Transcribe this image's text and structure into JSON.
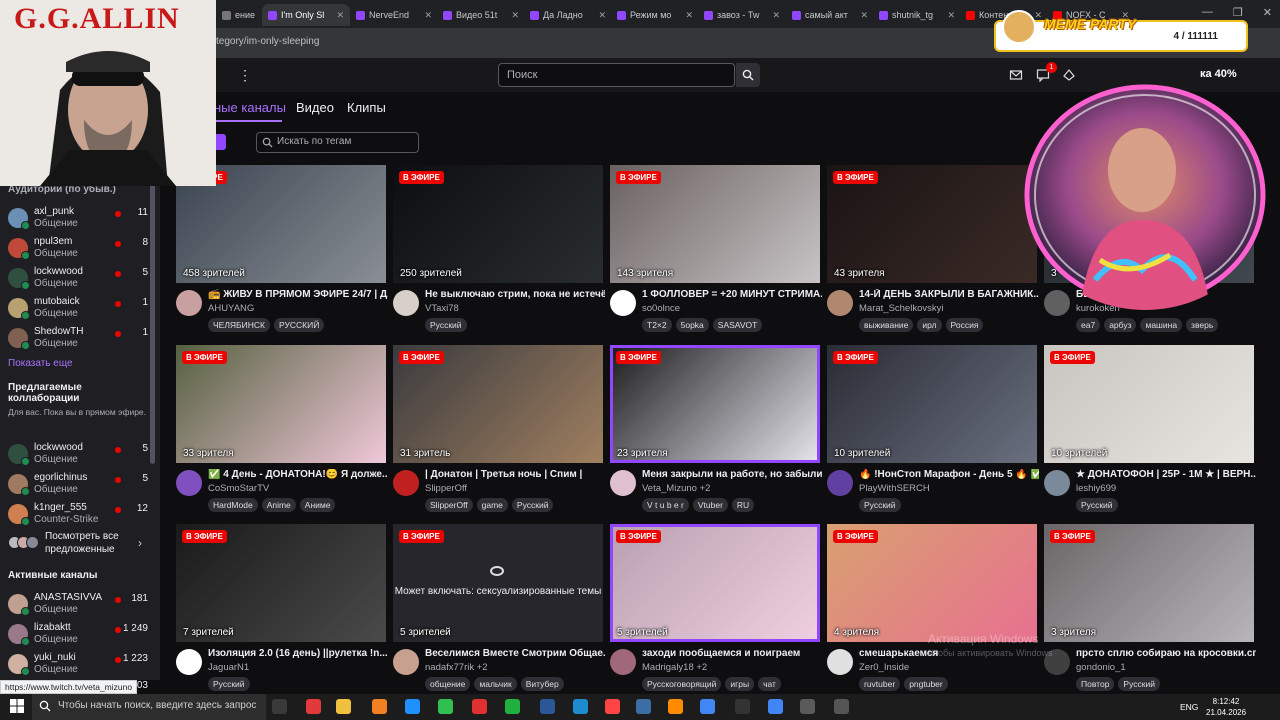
{
  "browser": {
    "tabs": [
      {
        "label": "ение",
        "fav": "#777777"
      },
      {
        "label": "I'm Only Sl",
        "fav": "#9147ff",
        "active": true
      },
      {
        "label": "NerveEnd",
        "fav": "#9147ff"
      },
      {
        "label": "Видео 51t",
        "fav": "#9147ff"
      },
      {
        "label": "Да Ладно",
        "fav": "#9147ff"
      },
      {
        "label": "Режим мо",
        "fav": "#9147ff"
      },
      {
        "label": "завоз - Tw",
        "fav": "#9147ff"
      },
      {
        "label": "самый акт",
        "fav": "#9147ff"
      },
      {
        "label": "shutnik_tg",
        "fav": "#9147ff"
      },
      {
        "label": "Контент",
        "fav": "#ff0000"
      },
      {
        "label": "NOFX - C",
        "fav": "#ff0000"
      }
    ],
    "url": "tegory/im-only-sleeping",
    "window_controls": [
      "—",
      "❐",
      "✕"
    ]
  },
  "topnav": {
    "search_placeholder": "Поиск",
    "notifications_count": "1",
    "prime_percent": "ка 40%"
  },
  "sidebar": {
    "audience_heading": "Аудитории (по убыв.)",
    "followed": [
      {
        "name": "axl_punk",
        "game": "Общение",
        "viewers": "11",
        "color": "#6b8fb5"
      },
      {
        "name": "npul3em",
        "game": "Общение",
        "viewers": "8",
        "color": "#c04a3a"
      },
      {
        "name": "lockwwood",
        "game": "Общение",
        "viewers": "5",
        "color": "#2f4f3f"
      },
      {
        "name": "mutobaick",
        "game": "Общение",
        "viewers": "1",
        "color": "#b8a070"
      },
      {
        "name": "ShedowTH",
        "game": "Общение",
        "viewers": "1",
        "color": "#806050"
      }
    ],
    "show_more": "Показать еще",
    "collab_heading": "Предлагаемые коллаборации",
    "collab_sub": "Для вас. Пока вы в прямом эфире.",
    "collabs": [
      {
        "name": "lockwwood",
        "game": "Общение",
        "viewers": "5",
        "color": "#2f4f3f"
      },
      {
        "name": "egorlichinus",
        "game": "Общение",
        "viewers": "5",
        "color": "#a07a60"
      },
      {
        "name": "k1nger_555",
        "game": "Counter-Strike",
        "viewers": "12",
        "color": "#d08050"
      }
    ],
    "see_all": "Посмотреть все предложенные",
    "active_heading": "Активные каналы",
    "active": [
      {
        "name": "ANASTASIVVA",
        "game": "Общение",
        "viewers": "181",
        "color": "#c0a090"
      },
      {
        "name": "lizabaktt",
        "game": "Общение",
        "viewers": "1 249",
        "color": "#9a7a8a"
      },
      {
        "name": "yuki_nuki",
        "game": "Общение",
        "viewers": "1 223",
        "color": "#d0b0a0"
      }
    ],
    "partial_count": "03"
  },
  "content": {
    "tabs": [
      "ные каналы",
      "Видео",
      "Клипы"
    ],
    "tag_search_placeholder": "Искать по тегам",
    "live_label": "В ЭФИРЕ"
  },
  "cards": [
    {
      "viewers": "458 зрителей",
      "title": "📻 ЖИВУ В ПРЯМОМ ЭФИРЕ 24/7 | Д...",
      "channel": "AHUYANG",
      "tags": [
        "ЧЕЛЯБИНСК",
        "РУССКИЙ"
      ],
      "thumb": "#3a4450",
      "thumb2": "#8a8f95",
      "avatar": "#c9a0a0"
    },
    {
      "viewers": "250 зрителей",
      "title": "Не выключаю стрим, пока не истечё...",
      "channel": "VTaxi78",
      "tags": [
        "Русский"
      ],
      "thumb": "#0c0e12",
      "thumb2": "#2a2d30",
      "avatar": "#d8d0c8"
    },
    {
      "viewers": "143 зрителя",
      "title": "1 ФОЛЛОВЕР = +20 МИНУТ СТРИМА...",
      "channel": "so0olnce",
      "tags": [
        "T2×2",
        "5opka",
        "SASAVOT"
      ],
      "thumb": "#6a6060",
      "thumb2": "#c8c4c6",
      "avatar": "#ffffff"
    },
    {
      "viewers": "43 зрителя",
      "title": "14-Й ДЕНЬ ЗАКРЫЛИ В БАГАЖНИК...",
      "channel": "Marat_Schelkovskyi",
      "tags": [
        "выживание",
        "ирл",
        "Россия"
      ],
      "thumb": "#1a1414",
      "thumb2": "#3a2a26",
      "avatar": "#b08870"
    },
    {
      "viewers": "3",
      "title": "БЕСК... 2 ДЕНЬ | Н...",
      "channel": "kurokoken",
      "tags": [
        "ea7",
        "арбуз",
        "машина",
        "зверь"
      ],
      "thumb": "#20242a",
      "thumb2": "#404850",
      "avatar": "#606060"
    },
    {
      "viewers": "33 зрителя",
      "title": "✅ 4 День - ДОНАТОНА!😊 Я долже...",
      "channel": "CoSmoStarTV",
      "tags": [
        "HardMode",
        "Anime",
        "Аниме"
      ],
      "thumb": "#556040",
      "thumb2": "#f0c8d8",
      "avatar": "#8050c0"
    },
    {
      "viewers": "31 зритель",
      "title": "| Донатон | Третья ночь | Спим |",
      "channel": "SlipperOff",
      "tags": [
        "SlipperOff",
        "game",
        "Русский"
      ],
      "thumb": "#3a3a3e",
      "thumb2": "#a08060",
      "avatar": "#c02020"
    },
    {
      "viewers": "23 зрителя",
      "title": "Меня закрыли на работе, но забыли ...",
      "channel": "Veta_Mizuno +2",
      "tags": [
        "V t u b e r",
        "Vtuber",
        "RU"
      ],
      "thumb": "#1a1a1c",
      "thumb2": "#e8e6ee",
      "avatar": "#e0c0d0",
      "highlight": true
    },
    {
      "viewers": "10 зрителей",
      "title": "🔥 !НонСтоп Марафон - День 5 🔥 ✅...",
      "channel": "PlayWithSERCH",
      "tags": [
        "Русский"
      ],
      "thumb": "#2a2c34",
      "thumb2": "#6a7080",
      "avatar": "#6040a0"
    },
    {
      "viewers": "10 зрителей",
      "title": "★ ДОНАТОФОН | 25P - 1M ★ | ВЕРН...",
      "channel": "leshiy699",
      "tags": [
        "Русский"
      ],
      "thumb": "#c8c4c0",
      "thumb2": "#e8e4e0",
      "avatar": "#7a8a9a"
    },
    {
      "viewers": "7 зрителей",
      "title": "Изоляция 2.0 (16 день) ||рулетка !n...",
      "channel": "JaguarN1",
      "tags": [
        "Русский"
      ],
      "thumb": "#1a1a1a",
      "thumb2": "#4a4a4a",
      "avatar": "#ffffff"
    },
    {
      "viewers": "5 зрителей",
      "title": "Веселимся Вместе Смотрим Общае...",
      "channel": "nadafx77rik +2",
      "tags": [
        "общение",
        "мальчик",
        "Витубер"
      ],
      "thumb": "#26262c",
      "thumb2": "#26262c",
      "avatar": "#c8a090",
      "mature": "Может включать: сексуализированные темы"
    },
    {
      "viewers": "5 зрителей",
      "title": "заходи пообщаемся и поиграем",
      "channel": "Madrigaly18 +2",
      "tags": [
        "Русскоговорящий",
        "игры",
        "чат"
      ],
      "thumb": "#b8a0b0",
      "thumb2": "#f0d0e0",
      "avatar": "#a06878",
      "highlight": true
    },
    {
      "viewers": "4 зрителя",
      "title": "смешарькаемся",
      "channel": "Zer0_Inside",
      "tags": [
        "ruvtuber",
        "pngtuber"
      ],
      "thumb": "#d8a070",
      "thumb2": "#e87090",
      "avatar": "#e0e0e0"
    },
    {
      "viewers": "3 зрителя",
      "title": "прсто сплю собираю на кросовки.сп...",
      "channel": "gondonio_1",
      "tags": [
        "Повтор",
        "Русский"
      ],
      "thumb": "#6a6668",
      "thumb2": "#b8b4b8",
      "avatar": "#404040"
    }
  ],
  "overlays": {
    "gg_title": "G.G.ALLIN",
    "meme_title": "MEME PARTY",
    "meme_count": "4 / 111111",
    "activate_windows": "Активация Windows",
    "activate_windows_sub": "Чтобы активировать Windows",
    "status_url": "https://www.twitch.tv/veta_mizuno"
  },
  "taskbar": {
    "search_placeholder": "Чтобы начать поиск, введите здесь запрос",
    "apps": [
      "#3a3a3a",
      "#e23a3a",
      "#f0c040",
      "#f08020",
      "#1e90ff",
      "#30c050",
      "#e03030",
      "#20b040",
      "#2b5797",
      "#1e8ad0",
      "#ff4444",
      "#3a6ea5",
      "#ff8c00",
      "#4285f4",
      "#333333",
      "#4285f4",
      "#5a5a5a",
      "#555555"
    ],
    "lang": "ENG",
    "time": "8:12:42",
    "date": "21.04.2026"
  }
}
